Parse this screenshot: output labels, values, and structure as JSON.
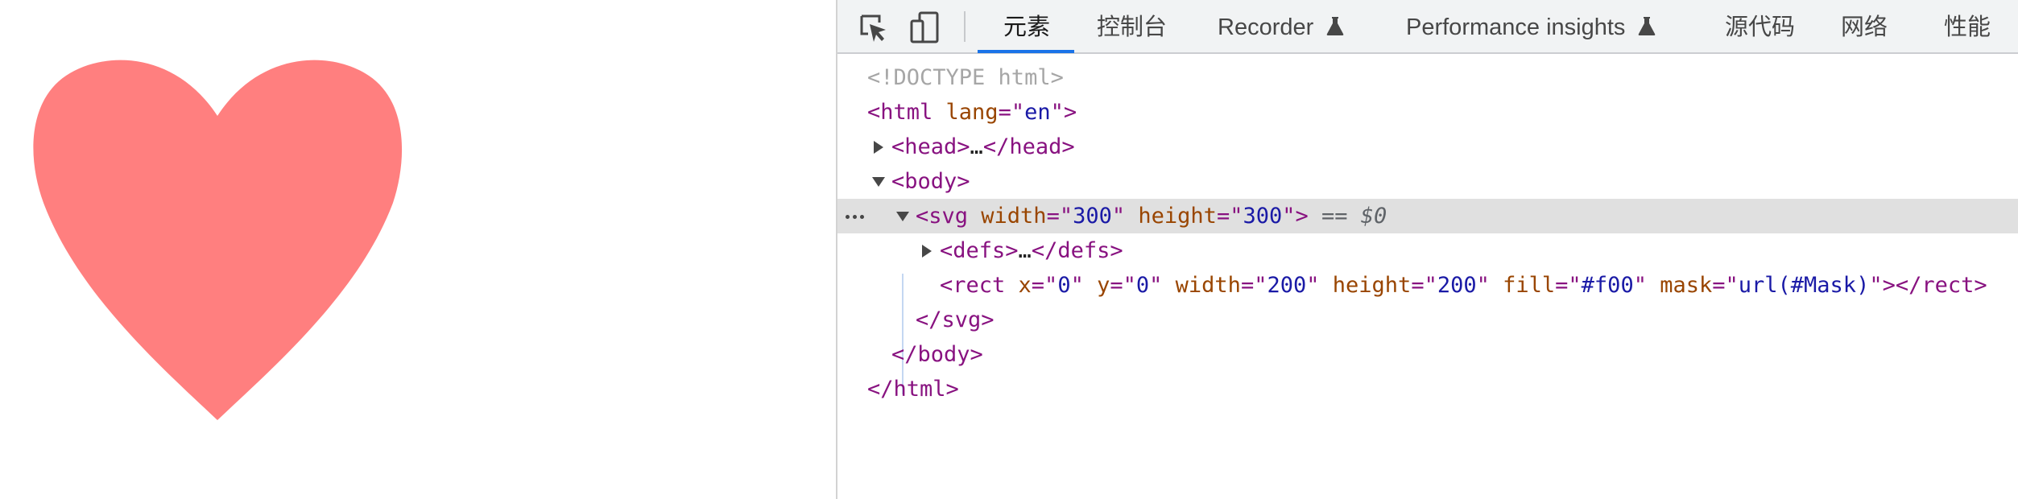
{
  "page": {
    "heart": {
      "color": "#ff7f7f",
      "name": "heart-shape"
    }
  },
  "devtools": {
    "toolbar": {
      "inspect_icon": "inspect-element-icon",
      "device_icon": "device-toolbar-icon",
      "tabs": [
        {
          "label": "元素",
          "active": true
        },
        {
          "label": "控制台",
          "active": false
        },
        {
          "label": "Recorder",
          "active": false,
          "icon": "flask-icon"
        },
        {
          "label": "Performance insights",
          "active": false,
          "icon": "flask-icon"
        },
        {
          "label": "源代码",
          "active": false
        },
        {
          "label": "网络",
          "active": false
        },
        {
          "label": "性能",
          "active": false
        }
      ]
    },
    "dom_tree": {
      "doctype": "<!DOCTYPE html>",
      "html_open_tag": "<html",
      "html_attr_name": " lang",
      "html_attr_eq": "=\"",
      "html_attr_value": "en",
      "html_attr_close": "\">",
      "head_collapsed": "<head>",
      "head_ellipsis": "…",
      "head_close": "</head>",
      "body_open": "<body>",
      "svg_open": "<svg",
      "svg_attr_width_name": " width",
      "svg_attr_width_value": "300",
      "svg_attr_height_name": " height",
      "svg_attr_height_value": "300",
      "svg_open_end": ">",
      "selected_marker": " == $0",
      "defs_collapsed": "<defs>",
      "defs_ellipsis": "…",
      "defs_close": "</defs>",
      "rect_open": "<rect",
      "rect_x_name": " x",
      "rect_x_value": "0",
      "rect_y_name": " y",
      "rect_y_value": "0",
      "rect_width_name": " width",
      "rect_width_value": "200",
      "rect_height_name": " height",
      "rect_height_value": "200",
      "rect_fill_name": " fill",
      "rect_fill_value": "#f00",
      "rect_mask_name": " mask",
      "rect_mask_value": "url(#Mask)",
      "rect_close": "></rect>",
      "svg_close": "</svg>",
      "body_close": "</body>",
      "html_close": "</html>"
    },
    "colors": {
      "tag": "#881280",
      "attr_name": "#994500",
      "attr_value": "#1a1aa6",
      "selected_row": "#e0e0e0",
      "active_tab_underline": "#1a73e8"
    }
  }
}
